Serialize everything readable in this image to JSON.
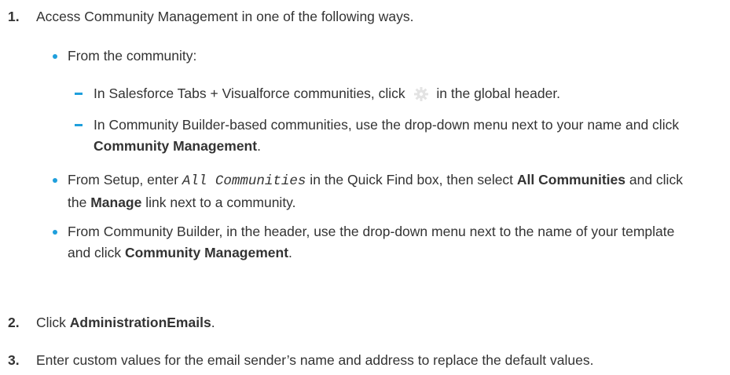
{
  "steps": [
    {
      "number": "1.",
      "text": "Access Community Management in one of the following ways."
    },
    {
      "number": "2.",
      "prefix": "Click ",
      "bold": "AdministrationEmails",
      "suffix": "."
    },
    {
      "number": "3.",
      "text": "Enter custom values for the email sender’s name and address to replace the default values."
    }
  ],
  "bullets": {
    "from_community": "From the community:",
    "setup": {
      "a": "From Setup, enter ",
      "code": "All Communities",
      "b": " in the Quick Find box, then select ",
      "bold1": "All Communities",
      "c": " and click the ",
      "bold2": "Manage",
      "d": " link next to a community."
    },
    "builder": {
      "a": "From Community Builder, in the header, use the drop-down menu next to the name of your template and click ",
      "bold": "Community Management",
      "b": "."
    }
  },
  "sub_items": {
    "tabs": {
      "a": "In Salesforce Tabs + Visualforce communities, click ",
      "icon": "gear-icon",
      "b": " in the global header."
    },
    "builder_based": {
      "a": "In Community Builder-based communities, use the drop-down menu next to your name and click ",
      "bold": "Community Management",
      "b": "."
    }
  },
  "colors": {
    "accent": "#1f9fdc",
    "text": "#333333"
  }
}
